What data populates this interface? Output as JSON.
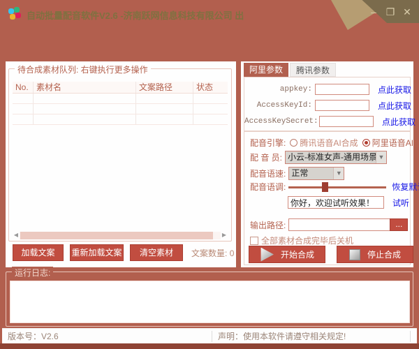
{
  "window": {
    "title": "自动批量配音软件V2.6 -济南跃网信息科技有限公司 出",
    "controls": {
      "minimize": "–",
      "maximize": "❐",
      "close": "✕"
    }
  },
  "colors": {
    "background": "#b25f4e",
    "accent_red": "#c14d40",
    "link_blue": "#1414e6",
    "tan_decoration": "#b69d72",
    "olive_decoration": "#7b6b4c"
  },
  "left_panel": {
    "group_title": "待合成素材队列: 右键执行更多操作",
    "table": {
      "headers": [
        "No.",
        "素材名",
        "文案路径",
        "状态"
      ],
      "rows": []
    },
    "buttons": [
      {
        "label": "加载文案"
      },
      {
        "label": "重新加载文案"
      },
      {
        "label": "清空素材"
      }
    ],
    "count_label": "文案数量:",
    "count_value": "0"
  },
  "right_panel": {
    "tabs": [
      {
        "label": "阿里参数",
        "active": true
      },
      {
        "label": "腾讯参数",
        "active": false
      }
    ],
    "api_fields": [
      {
        "label": "appkey:",
        "value": "",
        "link": "点此获取"
      },
      {
        "label": "AccessKeyId:",
        "value": "",
        "link": "点此获取"
      },
      {
        "label": "AccessKeySecret:",
        "value": "",
        "link": "点此获取"
      }
    ],
    "voice": {
      "engine_label": "配音引擎:",
      "engines": [
        {
          "label": "腾讯语音AI合成",
          "selected": false
        },
        {
          "label": "阿里语音AI合成",
          "selected": true
        }
      ],
      "speaker_label": "配 音 员:",
      "speaker_value": "小云-标准女声-通用场景",
      "speed_label": "配音语速:",
      "speed_value": "正常",
      "pitch_label": "配音语调:",
      "pitch_reset_link": "恢复默认",
      "preview_text": "你好，欢迎试听效果！",
      "preview_link": "试听",
      "dropdown_arrow_icon": "▼"
    },
    "output": {
      "label": "输出路径:",
      "value": "",
      "browse_label": "...",
      "shutdown_label": "全部素材合成完毕后关机"
    },
    "actions": [
      {
        "label": "开始合成"
      },
      {
        "label": "停止合成"
      }
    ]
  },
  "log": {
    "title": "运行日志:",
    "content": ""
  },
  "status_bar": {
    "version": "版本号：V2.6",
    "notice": "声明：使用本软件请遵守相关规定!"
  }
}
